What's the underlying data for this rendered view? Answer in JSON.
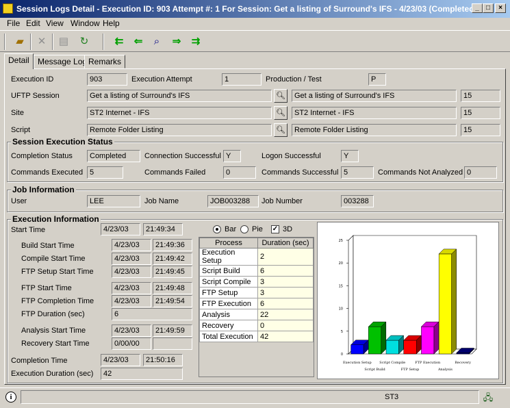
{
  "window": {
    "title": "Session Logs Detail - Execution ID: 903 Attempt #: 1 For Session: Get a listing of Surround's IFS - 4/23/03 (Completed)",
    "min": "_",
    "max": "□",
    "close": "×"
  },
  "menu": [
    "File",
    "Edit",
    "View",
    "Window",
    "Help"
  ],
  "tabs": [
    "Detail",
    "Message Log",
    "Remarks"
  ],
  "header": {
    "execution_id_label": "Execution ID",
    "execution_id": "903",
    "attempt_label": "Execution Attempt",
    "attempt": "1",
    "prodtest_label": "Production / Test",
    "prodtest": "P",
    "session_label": "UFTP Session",
    "session": "Get a listing of Surround's IFS",
    "session_name2": "Get a listing of Surround's IFS",
    "session_id": "15",
    "site_label": "Site",
    "site": "ST2 Internet - IFS",
    "site_name2": "ST2 Internet - IFS",
    "site_id": "15",
    "script_label": "Script",
    "script": "Remote Folder Listing",
    "script_name2": "Remote Folder Listing",
    "script_id": "15"
  },
  "status": {
    "title": "Session Execution Status",
    "completion_label": "Completion Status",
    "completion": "Completed",
    "conn_label": "Connection Successful",
    "conn": "Y",
    "logon_label": "Logon Successful",
    "logon": "Y",
    "cmd_exec_label": "Commands Executed",
    "cmd_exec": "5",
    "cmd_failed_label": "Commands Failed",
    "cmd_failed": "0",
    "cmd_success_label": "Commands Successful",
    "cmd_success": "5",
    "cmd_na_label": "Commands Not Analyzed",
    "cmd_na": "0"
  },
  "job": {
    "title": "Job Information",
    "user_label": "User",
    "user": "LEE",
    "name_label": "Job Name",
    "name": "JOB003288",
    "number_label": "Job Number",
    "number": "003288"
  },
  "exec": {
    "title": "Execution Information",
    "rows": [
      {
        "label": "Start Time",
        "date": "4/23/03",
        "time": "21:49:34"
      },
      {
        "label": "Build Start Time",
        "date": "4/23/03",
        "time": "21:49:36"
      },
      {
        "label": "Compile Start Time",
        "date": "4/23/03",
        "time": "21:49:42"
      },
      {
        "label": "FTP Setup Start Time",
        "date": "4/23/03",
        "time": "21:49:45"
      },
      {
        "label": "FTP Start Time",
        "date": "4/23/03",
        "time": "21:49:48"
      },
      {
        "label": "FTP Completion Time",
        "date": "4/23/03",
        "time": "21:49:54"
      },
      {
        "label": "FTP Duration (sec)",
        "date": "6",
        "time": ""
      },
      {
        "label": "Analysis Start Time",
        "date": "4/23/03",
        "time": "21:49:59"
      },
      {
        "label": "Recovery Start Time",
        "date": "0/00/00",
        "time": ""
      },
      {
        "label": "Completion Time",
        "date": "4/23/03",
        "time": "21:50:16"
      },
      {
        "label": "Execution Duration (sec)",
        "date": "42",
        "time": ""
      }
    ]
  },
  "chart_options": {
    "bar": "Bar",
    "pie": "Pie",
    "threed": "3D",
    "selected": "Bar",
    "threed_checked": true
  },
  "process_table": {
    "headers": [
      "Process",
      "Duration (sec)"
    ],
    "rows": [
      [
        "Execution Setup",
        "2"
      ],
      [
        "Script Build",
        "6"
      ],
      [
        "Script Compile",
        "3"
      ],
      [
        "FTP Setup",
        "3"
      ],
      [
        "FTP Execution",
        "6"
      ],
      [
        "Analysis",
        "22"
      ],
      [
        "Recovery",
        "0"
      ],
      [
        "Total Execution",
        "42"
      ]
    ]
  },
  "chart_data": {
    "type": "bar",
    "categories": [
      "Execution Setup",
      "Script Build",
      "Script Compile",
      "FTP Setup",
      "FTP Execution",
      "Analysis",
      "Recovery"
    ],
    "values": [
      2,
      6,
      3,
      3,
      6,
      22,
      0
    ],
    "colors": [
      "#0000ff",
      "#00c000",
      "#00e0e0",
      "#ff0000",
      "#ff00ff",
      "#ffff00",
      "#000080"
    ],
    "yticks": [
      "0",
      "5",
      "10",
      "15",
      "20",
      "25"
    ],
    "ylim": [
      0,
      25
    ],
    "grid": false
  },
  "statusbar": {
    "text": "ST3"
  }
}
